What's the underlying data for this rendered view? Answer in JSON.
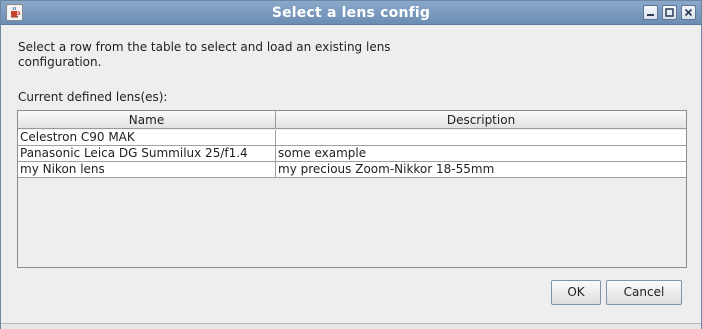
{
  "window": {
    "title": "Select a lens config",
    "app_icon": "java-coffee-icon",
    "controls": [
      "minimize-icon",
      "maximize-icon",
      "close-icon"
    ]
  },
  "message": "Select a row from the table to select and load an existing lens configuration.",
  "table_label": "Current defined lens(es):",
  "table": {
    "columns": [
      "Name",
      "Description"
    ],
    "rows": [
      {
        "name": "Celestron C90 MAK",
        "description": ""
      },
      {
        "name": "Panasonic Leica DG Summilux 25/f1.4",
        "description": "some example"
      },
      {
        "name": "my Nikon lens",
        "description": "my precious Zoom-Nikkor 18-55mm"
      }
    ]
  },
  "buttons": {
    "ok": "OK",
    "cancel": "Cancel"
  }
}
